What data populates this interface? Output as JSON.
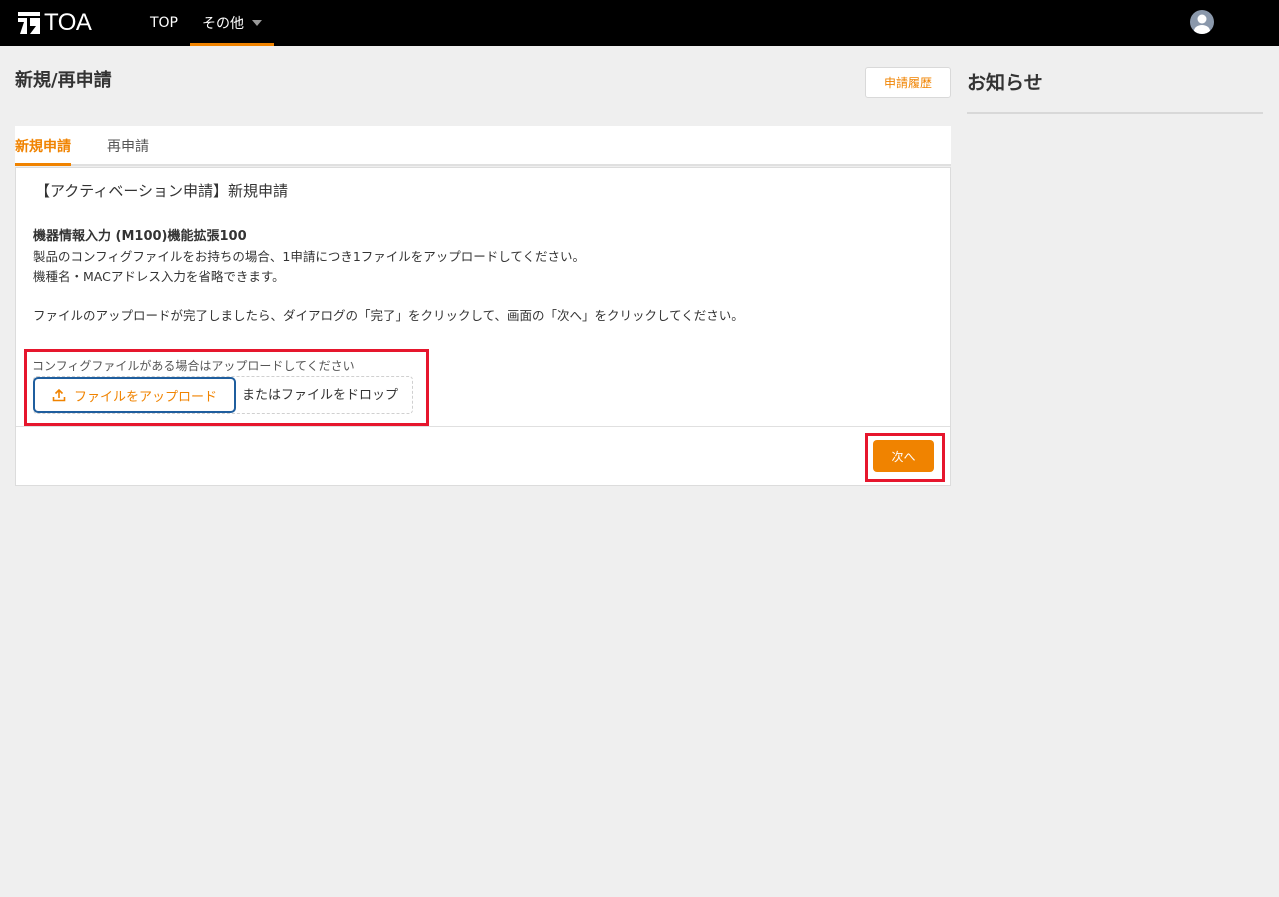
{
  "header": {
    "logo_text": "TOA",
    "nav": [
      {
        "label": "TOP"
      },
      {
        "label": "その他"
      }
    ]
  },
  "page": {
    "title": "新規/再申請",
    "history_button": "申請履歴",
    "news_title": "お知らせ"
  },
  "tabs": [
    {
      "label": "新規申請",
      "active": true
    },
    {
      "label": "再申請",
      "active": false
    }
  ],
  "form": {
    "title": "【アクティベーション申請】新規申請",
    "section_heading": "機器情報入力 (M100)機能拡張100",
    "desc_line1": "製品のコンフィグファイルをお持ちの場合、1申請につき1ファイルをアップロードしてください。",
    "desc_line2": "機種名・MACアドレス入力を省略できます。",
    "desc_line3": "ファイルのアップロードが完了しましたら、ダイアログの「完了」をクリックして、画面の「次へ」をクリックしてください。",
    "upload_label": "コンフィグファイルがある場合はアップロードしてください",
    "upload_button": "ファイルをアップロード",
    "drop_text": "またはファイルをドロップ",
    "next_button": "次へ"
  },
  "colors": {
    "accent": "#f08300",
    "highlight": "#e6162d",
    "upload_border": "#1f5e9e"
  },
  "icons": [
    "toa-logo-icon",
    "caret-down-icon",
    "user-avatar-icon",
    "upload-icon"
  ]
}
